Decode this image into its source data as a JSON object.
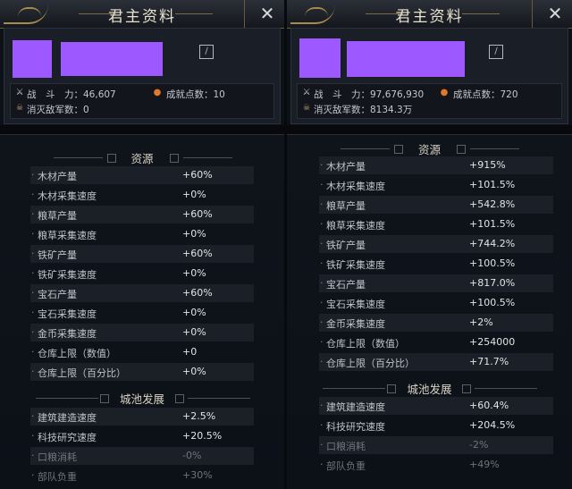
{
  "panels": [
    {
      "title": "君主资料",
      "stats": {
        "power_label": "战　斗　力：",
        "power_value": "46,607",
        "achievement_label": "成就点数：",
        "achievement_value": "10",
        "kills_label": "消灭敌军数：",
        "kills_value": "0"
      },
      "sections": [
        {
          "title": "资源",
          "rows": [
            {
              "name": "木材产量",
              "value": "+60%"
            },
            {
              "name": "木材采集速度",
              "value": "+0%"
            },
            {
              "name": "粮草产量",
              "value": "+60%"
            },
            {
              "name": "粮草采集速度",
              "value": "+0%"
            },
            {
              "name": "铁矿产量",
              "value": "+60%"
            },
            {
              "name": "铁矿采集速度",
              "value": "+0%"
            },
            {
              "name": "宝石产量",
              "value": "+60%"
            },
            {
              "name": "宝石采集速度",
              "value": "+0%"
            },
            {
              "name": "金币采集速度",
              "value": "+0%"
            },
            {
              "name": "仓库上限（数值）",
              "value": "+0"
            },
            {
              "name": "仓库上限（百分比）",
              "value": "+0%"
            }
          ]
        },
        {
          "title": "城池发展",
          "rows": [
            {
              "name": "建筑建造速度",
              "value": "+2.5%"
            },
            {
              "name": "科技研究速度",
              "value": "+20.5%"
            },
            {
              "name": "口粮消耗",
              "value": "-0%"
            },
            {
              "name": "部队负重",
              "value": "+30%"
            }
          ]
        }
      ]
    },
    {
      "title": "君主资料",
      "stats": {
        "power_label": "战　斗　力：",
        "power_value": "97,676,930",
        "achievement_label": "成就点数：",
        "achievement_value": "720",
        "kills_label": "消灭敌军数：",
        "kills_value": "8134.3万"
      },
      "sections": [
        {
          "title": "资源",
          "rows": [
            {
              "name": "木材产量",
              "value": "+915%"
            },
            {
              "name": "木材采集速度",
              "value": "+101.5%"
            },
            {
              "name": "粮草产量",
              "value": "+542.8%"
            },
            {
              "name": "粮草采集速度",
              "value": "+101.5%"
            },
            {
              "name": "铁矿产量",
              "value": "+744.2%"
            },
            {
              "name": "铁矿采集速度",
              "value": "+100.5%"
            },
            {
              "name": "宝石产量",
              "value": "+817.0%"
            },
            {
              "name": "宝石采集速度",
              "value": "+100.5%"
            },
            {
              "name": "金币采集速度",
              "value": "+2%"
            },
            {
              "name": "仓库上限（数值）",
              "value": "+254000"
            },
            {
              "name": "仓库上限（百分比）",
              "value": "+71.7%"
            }
          ]
        },
        {
          "title": "城池发展",
          "rows": [
            {
              "name": "建筑建造速度",
              "value": "+60.4%"
            },
            {
              "name": "科技研究速度",
              "value": "+204.5%"
            },
            {
              "name": "口粮消耗",
              "value": "-2%"
            },
            {
              "name": "部队负重",
              "value": "+49%"
            }
          ]
        }
      ]
    }
  ],
  "colors": {
    "accent_gold": "#a88b4c",
    "redacted_purple": "#9e58ff",
    "achievement_orange": "#e07a2a"
  }
}
